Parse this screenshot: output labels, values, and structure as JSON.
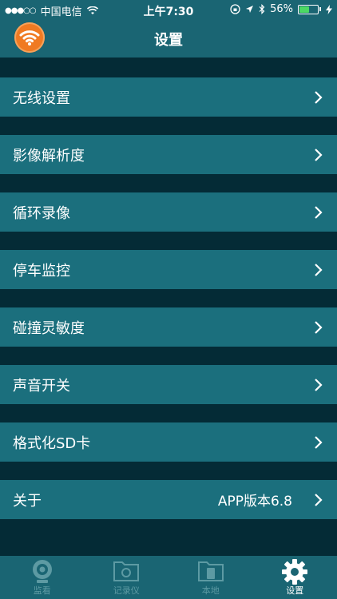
{
  "status_bar": {
    "signal_dots": "●●●○○",
    "carrier": "中国电信",
    "time": "上午7:30",
    "battery_percent": "56%",
    "battery_level": 0.56
  },
  "nav": {
    "title": "设置",
    "logo_icon": "wifi-icon"
  },
  "settings": {
    "items": [
      {
        "label": "无线设置",
        "value": ""
      },
      {
        "label": "影像解析度",
        "value": ""
      },
      {
        "label": "循环录像",
        "value": ""
      },
      {
        "label": "停车监控",
        "value": ""
      },
      {
        "label": "碰撞灵敏度",
        "value": ""
      },
      {
        "label": "声音开关",
        "value": ""
      },
      {
        "label": "格式化SD卡",
        "value": ""
      },
      {
        "label": "关于",
        "value": "APP版本6.8"
      }
    ]
  },
  "tab_bar": {
    "tabs": [
      {
        "label": "监看",
        "icon": "camera-lens-icon",
        "active": false
      },
      {
        "label": "记录仪",
        "icon": "folder-camera-icon",
        "active": false
      },
      {
        "label": "本地",
        "icon": "folder-phone-icon",
        "active": false
      },
      {
        "label": "设置",
        "icon": "gear-icon",
        "active": true
      }
    ]
  },
  "colors": {
    "background": "#042b36",
    "bar": "#1a6573",
    "row": "#1b6f7d",
    "logo": "#f07a22",
    "tab_inactive": "#5d9aa3"
  }
}
